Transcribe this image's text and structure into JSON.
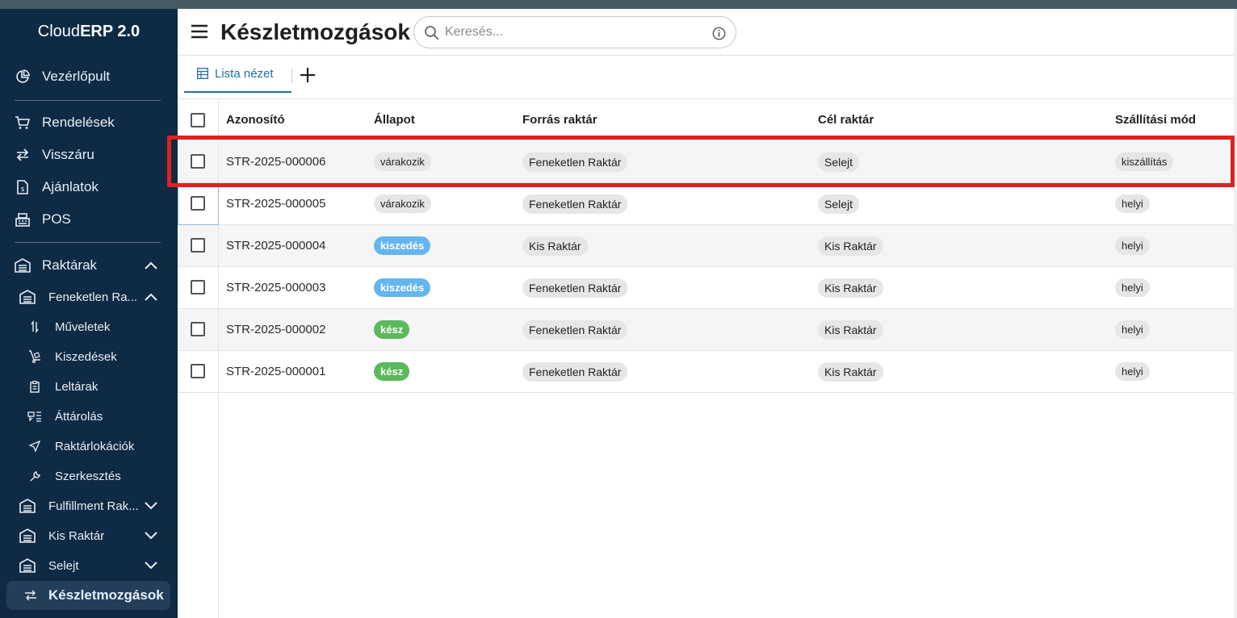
{
  "app": {
    "brand_plain": "Cloud",
    "brand_bold": "ERP 2.0"
  },
  "sidebar": {
    "dashboard": "Vezérlőpult",
    "orders": "Rendelések",
    "returns": "Visszáru",
    "quotes": "Ajánlatok",
    "pos": "POS",
    "warehouses": "Raktárak",
    "wh1": "Feneketlen Ra...",
    "wh1_items": {
      "operations": "Műveletek",
      "picking": "Kiszedések",
      "inventories": "Leltárak",
      "transfer": "Áttárolás",
      "locations": "Raktárlokációk",
      "edit": "Szerkesztés"
    },
    "wh2": "Fulfillment Rak...",
    "wh3": "Kis Raktár",
    "wh4": "Selejt",
    "stock_moves": "Készletmozgások"
  },
  "header": {
    "title": "Készletmozgások",
    "search_placeholder": "Keresés..."
  },
  "tabs": {
    "list_view": "Lista nézet"
  },
  "table": {
    "columns": {
      "id": "Azonosító",
      "status": "Állapot",
      "source": "Forrás raktár",
      "target": "Cél raktár",
      "shipping": "Szállítási mód"
    },
    "rows": [
      {
        "id": "STR-2025-000006",
        "status": "várakozik",
        "source": "Feneketlen Raktár",
        "target": "Selejt",
        "shipping": "kiszállítás"
      },
      {
        "id": "STR-2025-000005",
        "status": "várakozik",
        "source": "Feneketlen Raktár",
        "target": "Selejt",
        "shipping": "helyi"
      },
      {
        "id": "STR-2025-000004",
        "status": "kiszedés",
        "source": "Kis Raktár",
        "target": "Kis Raktár",
        "shipping": "helyi"
      },
      {
        "id": "STR-2025-000003",
        "status": "kiszedés",
        "source": "Feneketlen Raktár",
        "target": "Kis Raktár",
        "shipping": "helyi"
      },
      {
        "id": "STR-2025-000002",
        "status": "kész",
        "source": "Feneketlen Raktár",
        "target": "Kis Raktár",
        "shipping": "helyi"
      },
      {
        "id": "STR-2025-000001",
        "status": "kész",
        "source": "Feneketlen Raktár",
        "target": "Kis Raktár",
        "shipping": "helyi"
      }
    ]
  },
  "colors": {
    "sidebar_bg": "#0f2a45",
    "accent": "#1f6fa8",
    "status_waiting": "#e6e6e6",
    "status_picking": "#64b5f0",
    "status_done": "#5cb85c",
    "highlight": "#e02020"
  }
}
